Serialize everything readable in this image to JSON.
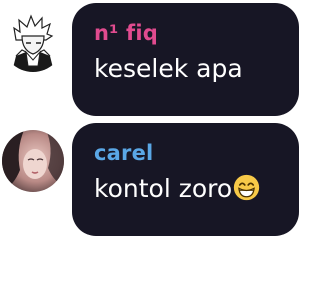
{
  "colors": {
    "bubble": "#171625",
    "message_text": "#ffffff",
    "user1_name": "#e14b8f",
    "user2_name": "#5aa7e6"
  },
  "messages": [
    {
      "sender": "n¹ fiq",
      "text": "keselek apa",
      "avatar": "anime-character-avatar"
    },
    {
      "sender": "carel",
      "text": "kontol zoro",
      "emoji": "grinning-face-icon",
      "avatar": "profile-photo-avatar"
    }
  ]
}
